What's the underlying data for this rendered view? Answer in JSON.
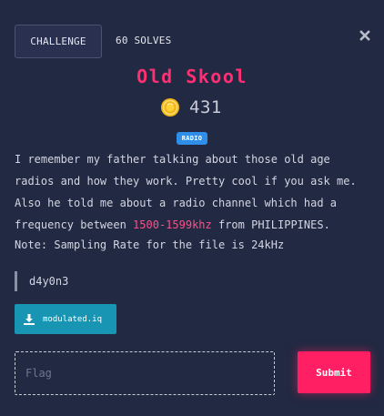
{
  "header": {
    "tab_label": "CHALLENGE",
    "solves": "60 SOLVES",
    "close_icon": "close-icon"
  },
  "challenge": {
    "title": "Old Skool",
    "coin_icon": "coin-icon",
    "points": "431",
    "category_badge": "RADIO",
    "description": {
      "part1": "I remember my father talking about those old age radios and how they work. Pretty cool if you ask me. Also he told me about a radio channel which had a frequency between ",
      "highlight": "1500-1599khz",
      "part2": " from PHILIPPINES."
    },
    "note": "Note: Sampling Rate for the file is 24kHz",
    "author": "d4y0n3",
    "attachment": {
      "icon": "download-icon",
      "filename": "modulated.iq"
    }
  },
  "form": {
    "flag_placeholder": "Flag",
    "flag_value": "",
    "submit_label": "Submit"
  },
  "colors": {
    "background": "#222942",
    "title": "#ff2f74",
    "highlight": "#ff4f8b",
    "badge": "#2f8fe8",
    "download": "#1795b3",
    "submit": "#ff1f62"
  }
}
